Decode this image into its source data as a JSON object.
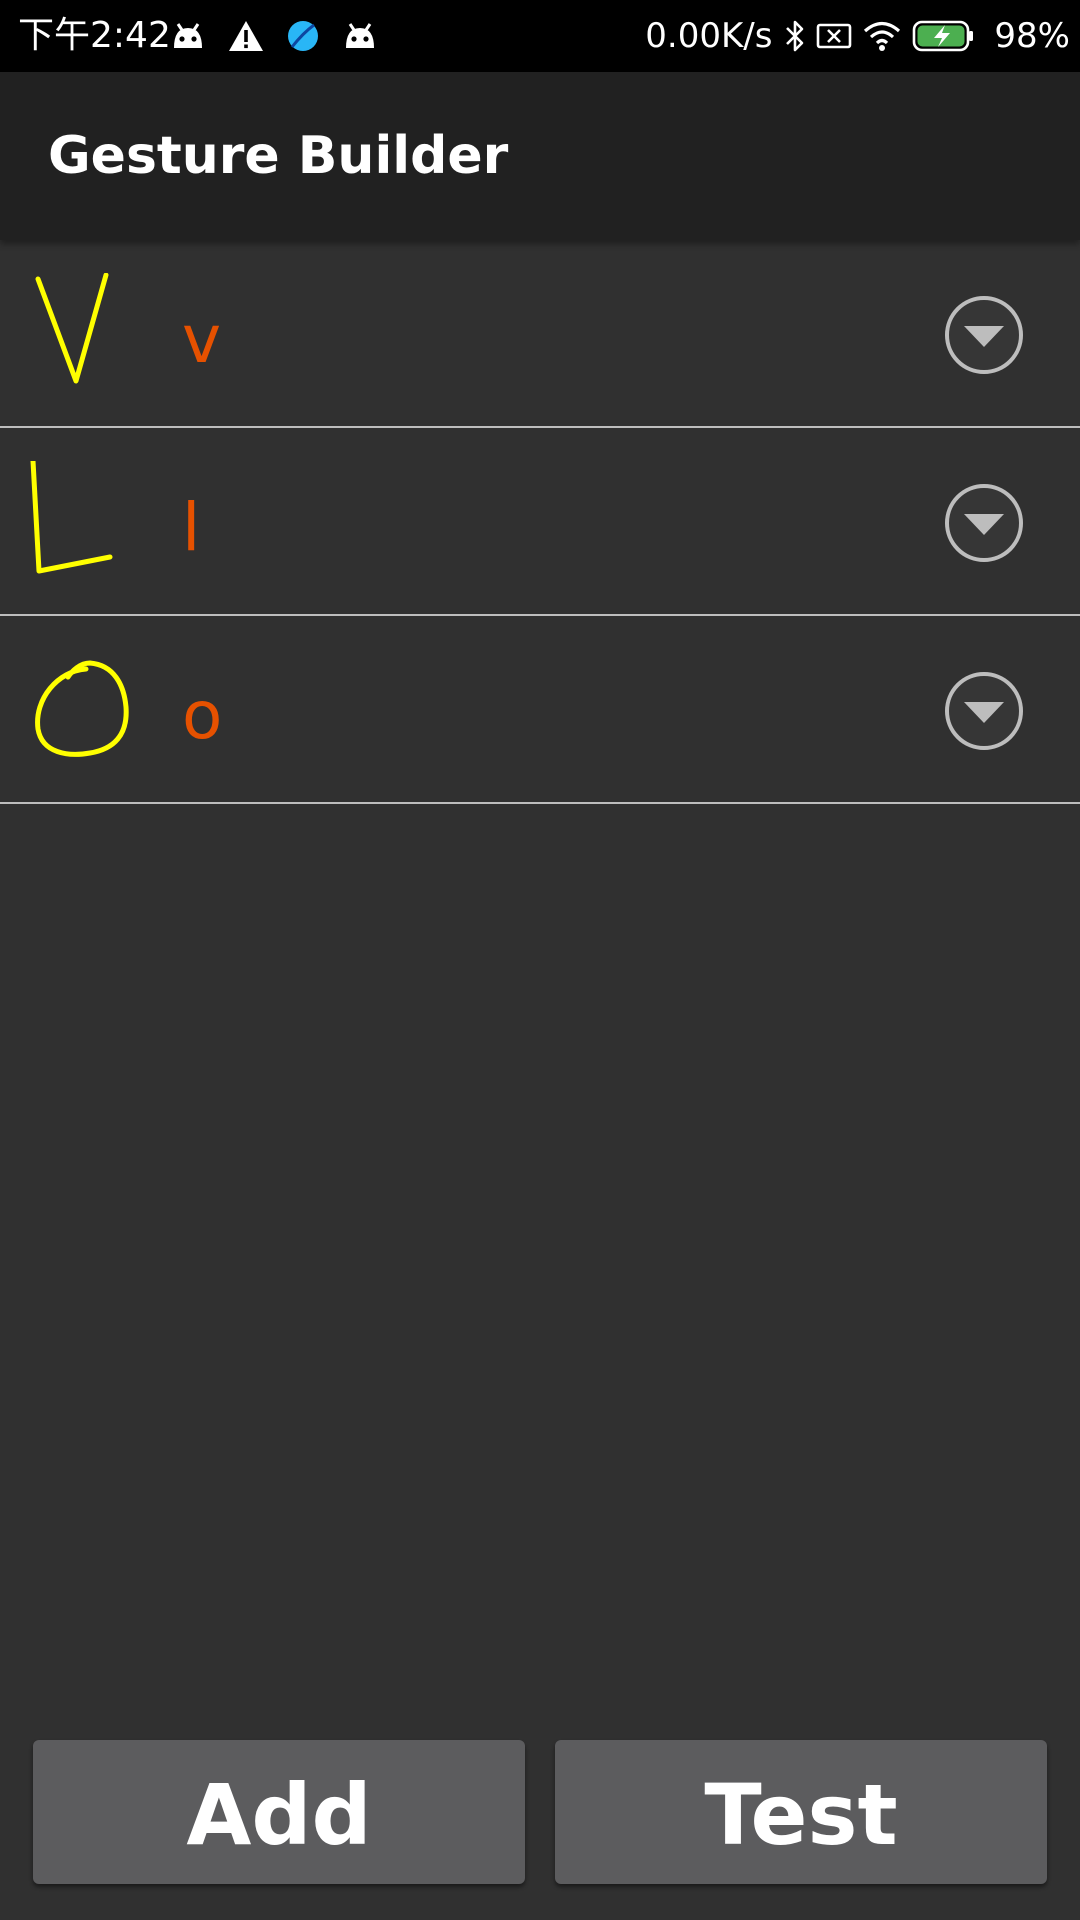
{
  "status_bar": {
    "time": "下午2:42",
    "left_icons": [
      "android-icon",
      "warning-icon",
      "browser-icon",
      "android-icon"
    ],
    "network_speed": "0.00K/s",
    "right_icons": [
      "bluetooth-icon",
      "no-sim-icon",
      "wifi-icon",
      "battery-charging-icon"
    ],
    "battery_percent": "98%",
    "battery_color": "#4caf50"
  },
  "app_bar": {
    "title": "Gesture Builder",
    "background": "#212121"
  },
  "gestures": [
    {
      "name": "v",
      "thumbnail_icon": "gesture-v-stroke"
    },
    {
      "name": "l",
      "thumbnail_icon": "gesture-l-stroke"
    },
    {
      "name": "o",
      "thumbnail_icon": "gesture-o-stroke"
    }
  ],
  "colors": {
    "gesture_stroke": "#ffff00",
    "gesture_name": "#e65100",
    "list_background": "#303030",
    "divider": "#bdbdbd",
    "button_background": "#5c5c5e"
  },
  "buttons": {
    "add_label": "Add",
    "test_label": "Test"
  }
}
